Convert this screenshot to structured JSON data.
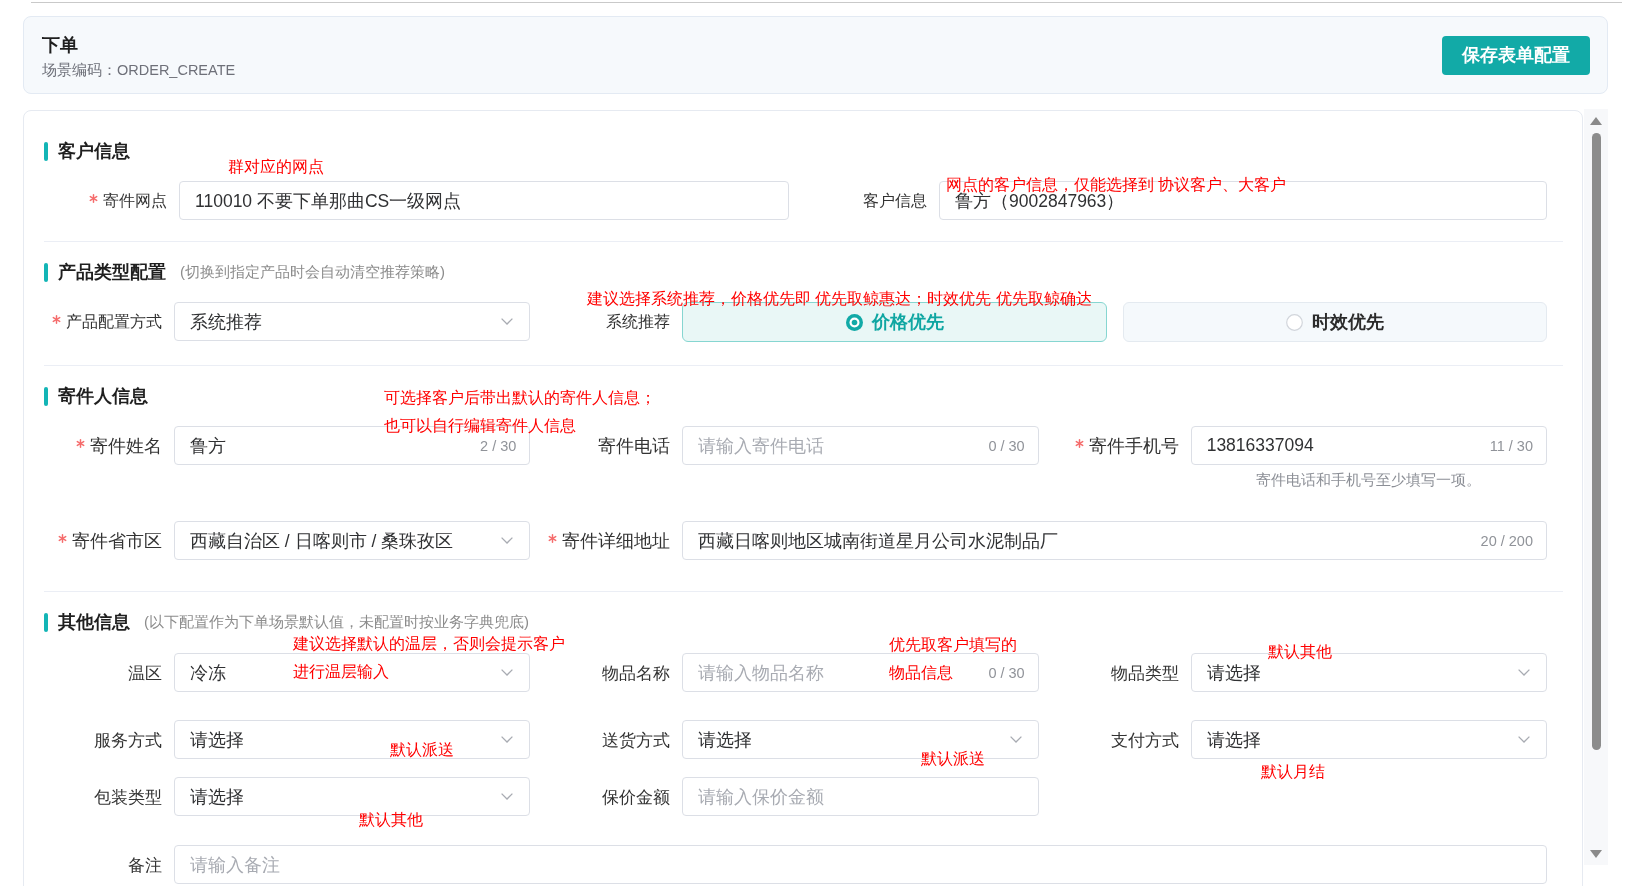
{
  "header": {
    "title": "下单",
    "scene_code": "场景编码：ORDER_CREATE",
    "save_button": "保存表单配置"
  },
  "sections": [
    {
      "title": "客户信息",
      "rows": [
        {
          "fields": [
            {
              "kind": "input",
              "label": "寄件网点",
              "required": true,
              "value": "110010 不要下单那曲CS一级网点"
            },
            {
              "kind": "input",
              "label": "客户信息",
              "required": false,
              "value": "鲁方（9002847963）"
            }
          ]
        }
      ]
    },
    {
      "title": "产品类型配置",
      "hint": "(切换到指定产品时会自动清空推荐策略)",
      "rows": [
        {
          "fields": [
            {
              "kind": "select",
              "label": "产品配置方式",
              "required": true,
              "value": "系统推荐"
            },
            {
              "kind": "radio",
              "label": "系统推荐",
              "required": false,
              "options": [
                {
                  "label": "价格优先",
                  "selected": true
                },
                {
                  "label": "时效优先",
                  "selected": false
                }
              ]
            }
          ]
        }
      ]
    },
    {
      "title": "寄件人信息",
      "rows": [
        {
          "fields": [
            {
              "kind": "input",
              "label": "寄件姓名",
              "required": true,
              "value": "鲁方",
              "counter": "2 / 30"
            },
            {
              "kind": "input",
              "label": "寄件电话",
              "required": false,
              "placeholder": "请输入寄件电话",
              "counter": "0 / 30"
            },
            {
              "kind": "input",
              "label": "寄件手机号",
              "required": true,
              "value": "13816337094",
              "counter": "11 / 30",
              "help": "寄件电话和手机号至少填写一项。"
            }
          ]
        },
        {
          "fields": [
            {
              "kind": "select",
              "label": "寄件省市区",
              "required": true,
              "value": "西藏自治区 / 日喀则市 / 桑珠孜区"
            },
            {
              "kind": "input",
              "label": "寄件详细地址",
              "required": true,
              "value": "西藏日喀则地区城南街道星月公司水泥制品厂",
              "counter": "20 / 200"
            }
          ]
        }
      ]
    },
    {
      "title": "其他信息",
      "hint": "(以下配置作为下单场景默认值，未配置时按业务字典兜底)",
      "rows": [
        {
          "fields": [
            {
              "kind": "select",
              "label": "温区",
              "required": false,
              "value": "冷冻"
            },
            {
              "kind": "input",
              "label": "物品名称",
              "required": false,
              "placeholder": "请输入物品名称",
              "counter": "0 / 30"
            },
            {
              "kind": "select",
              "label": "物品类型",
              "required": false,
              "value": "请选择"
            }
          ]
        },
        {
          "fields": [
            {
              "kind": "select",
              "label": "服务方式",
              "required": false,
              "value": "请选择"
            },
            {
              "kind": "select",
              "label": "送货方式",
              "required": false,
              "value": "请选择"
            },
            {
              "kind": "select",
              "label": "支付方式",
              "required": false,
              "value": "请选择"
            }
          ]
        },
        {
          "fields": [
            {
              "kind": "select",
              "label": "包装类型",
              "required": false,
              "value": "请选择"
            },
            {
              "kind": "input",
              "label": "保价金额",
              "required": false,
              "placeholder": "请输入保价金额"
            }
          ]
        },
        {
          "fields": [
            {
              "kind": "input",
              "label": "备注",
              "required": false,
              "placeholder": "请输入备注"
            }
          ]
        }
      ]
    }
  ],
  "annotations": [
    {
      "lines": [
        "群对应的网点"
      ]
    },
    {
      "lines": [
        "网点的客户信息，仅能选择到 协议客户、大客户"
      ]
    },
    {
      "lines": [
        "建议选择系统推荐，价格优先即 优先取鲸惠达；时效优先 优先取鲸确达"
      ]
    },
    {
      "lines": [
        "可选择客户后带出默认的寄件人信息；",
        "也可以自行编辑寄件人信息"
      ]
    },
    {
      "lines": [
        "建议选择默认的温层，否则会提示客户",
        "进行温层输入"
      ]
    },
    {
      "lines": [
        "优先取客户填写的",
        "物品信息"
      ]
    },
    {
      "lines": [
        "默认其他"
      ]
    },
    {
      "lines": [
        "默认派送"
      ]
    },
    {
      "lines": [
        "默认派送"
      ]
    },
    {
      "lines": [
        "默认月结"
      ]
    },
    {
      "lines": [
        "默认其他"
      ]
    }
  ]
}
